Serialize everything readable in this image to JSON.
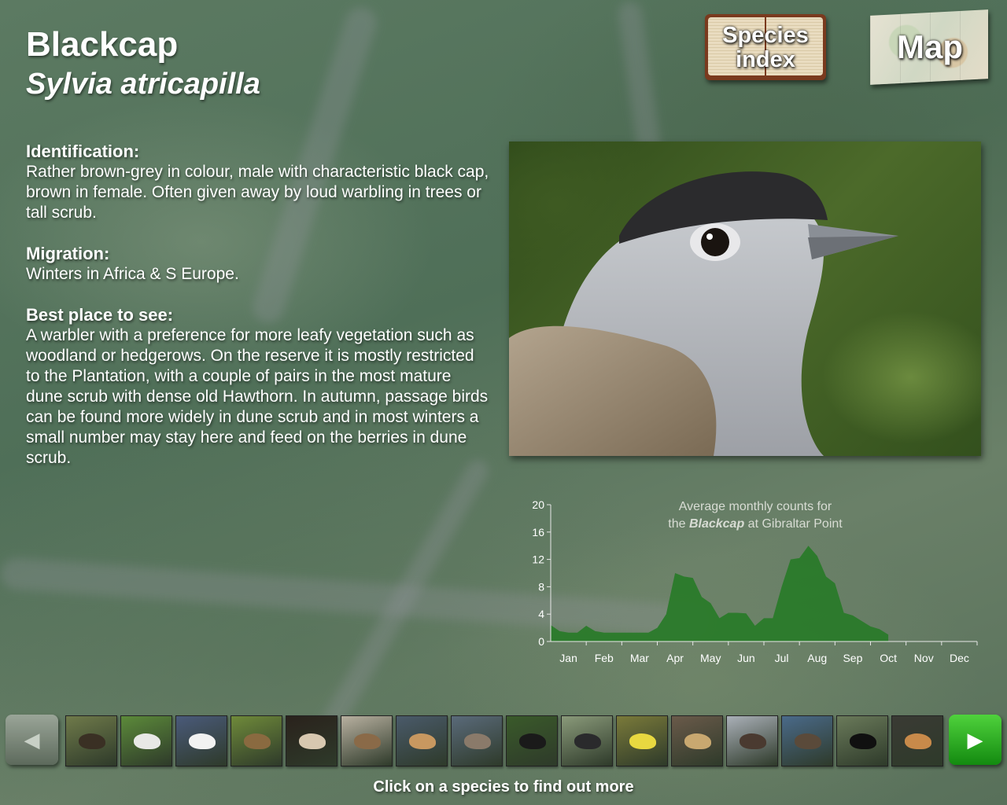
{
  "species": {
    "common_name": "Blackcap",
    "latin_name": "Sylvia atricapilla"
  },
  "sections": [
    {
      "heading": "Identification:",
      "text": "Rather brown-grey in colour, male with characteristic black cap, brown in female. Often given away by loud warbling in trees or tall scrub."
    },
    {
      "heading": "Migration:",
      "text": "Winters in Africa & S Europe."
    },
    {
      "heading": "Best place to see:",
      "text": "A warbler with a preference for more leafy vegetation such as woodland or hedgerows.  On the reserve it is mostly restricted to the Plantation, with a couple of pairs in the most mature dune scrub with dense old Hawthorn. In autumn, passage birds can be found more widely in dune scrub and in most winters a small number may stay here and feed on the berries in dune scrub."
    }
  ],
  "nav": {
    "species_index_line1": "Species",
    "species_index_line2": "index",
    "map_label": "Map"
  },
  "chart_data": {
    "type": "area",
    "title_line1": "Average monthly counts for",
    "title_line2_pre": "the",
    "title_line2_species": "Blackcap",
    "title_line2_post": "at Gibraltar Point",
    "categories": [
      "Jan",
      "Feb",
      "Mar",
      "Apr",
      "May",
      "Jun",
      "Jul",
      "Aug",
      "Sep",
      "Oct",
      "Nov",
      "Dec"
    ],
    "ylim": [
      0,
      20
    ],
    "yticks": [
      0,
      4,
      8,
      12,
      16,
      20
    ],
    "points_per_month": 4,
    "values": [
      2.4,
      1.5,
      1.3,
      1.3,
      2.3,
      1.5,
      1.3,
      1.3,
      1.3,
      1.3,
      1.3,
      1.3,
      2.0,
      4.0,
      10.0,
      9.5,
      9.3,
      6.5,
      5.6,
      3.4,
      4.2,
      4.2,
      4.1,
      2.3,
      3.4,
      3.4,
      8.0,
      12.0,
      12.2,
      14.0,
      12.5,
      9.5,
      8.5,
      4.2,
      3.8,
      3.0,
      2.2,
      1.8,
      1.0
    ],
    "fill_color": "#2a7a2a",
    "grid": false
  },
  "thumbnails": {
    "names": [
      "skua-icon",
      "tern-icon",
      "avocet-icon",
      "curlew-icon",
      "barn-owl-icon",
      "twite-icon",
      "wader-icon",
      "redshank-icon",
      "starling-icon",
      "blackcap-icon",
      "blue-tit-icon",
      "snow-bunting-icon",
      "brent-goose-icon",
      "canada-goose-icon",
      "blackbird-icon",
      "chaffinch-icon"
    ]
  },
  "footer_text": "Click on a species to find out more"
}
